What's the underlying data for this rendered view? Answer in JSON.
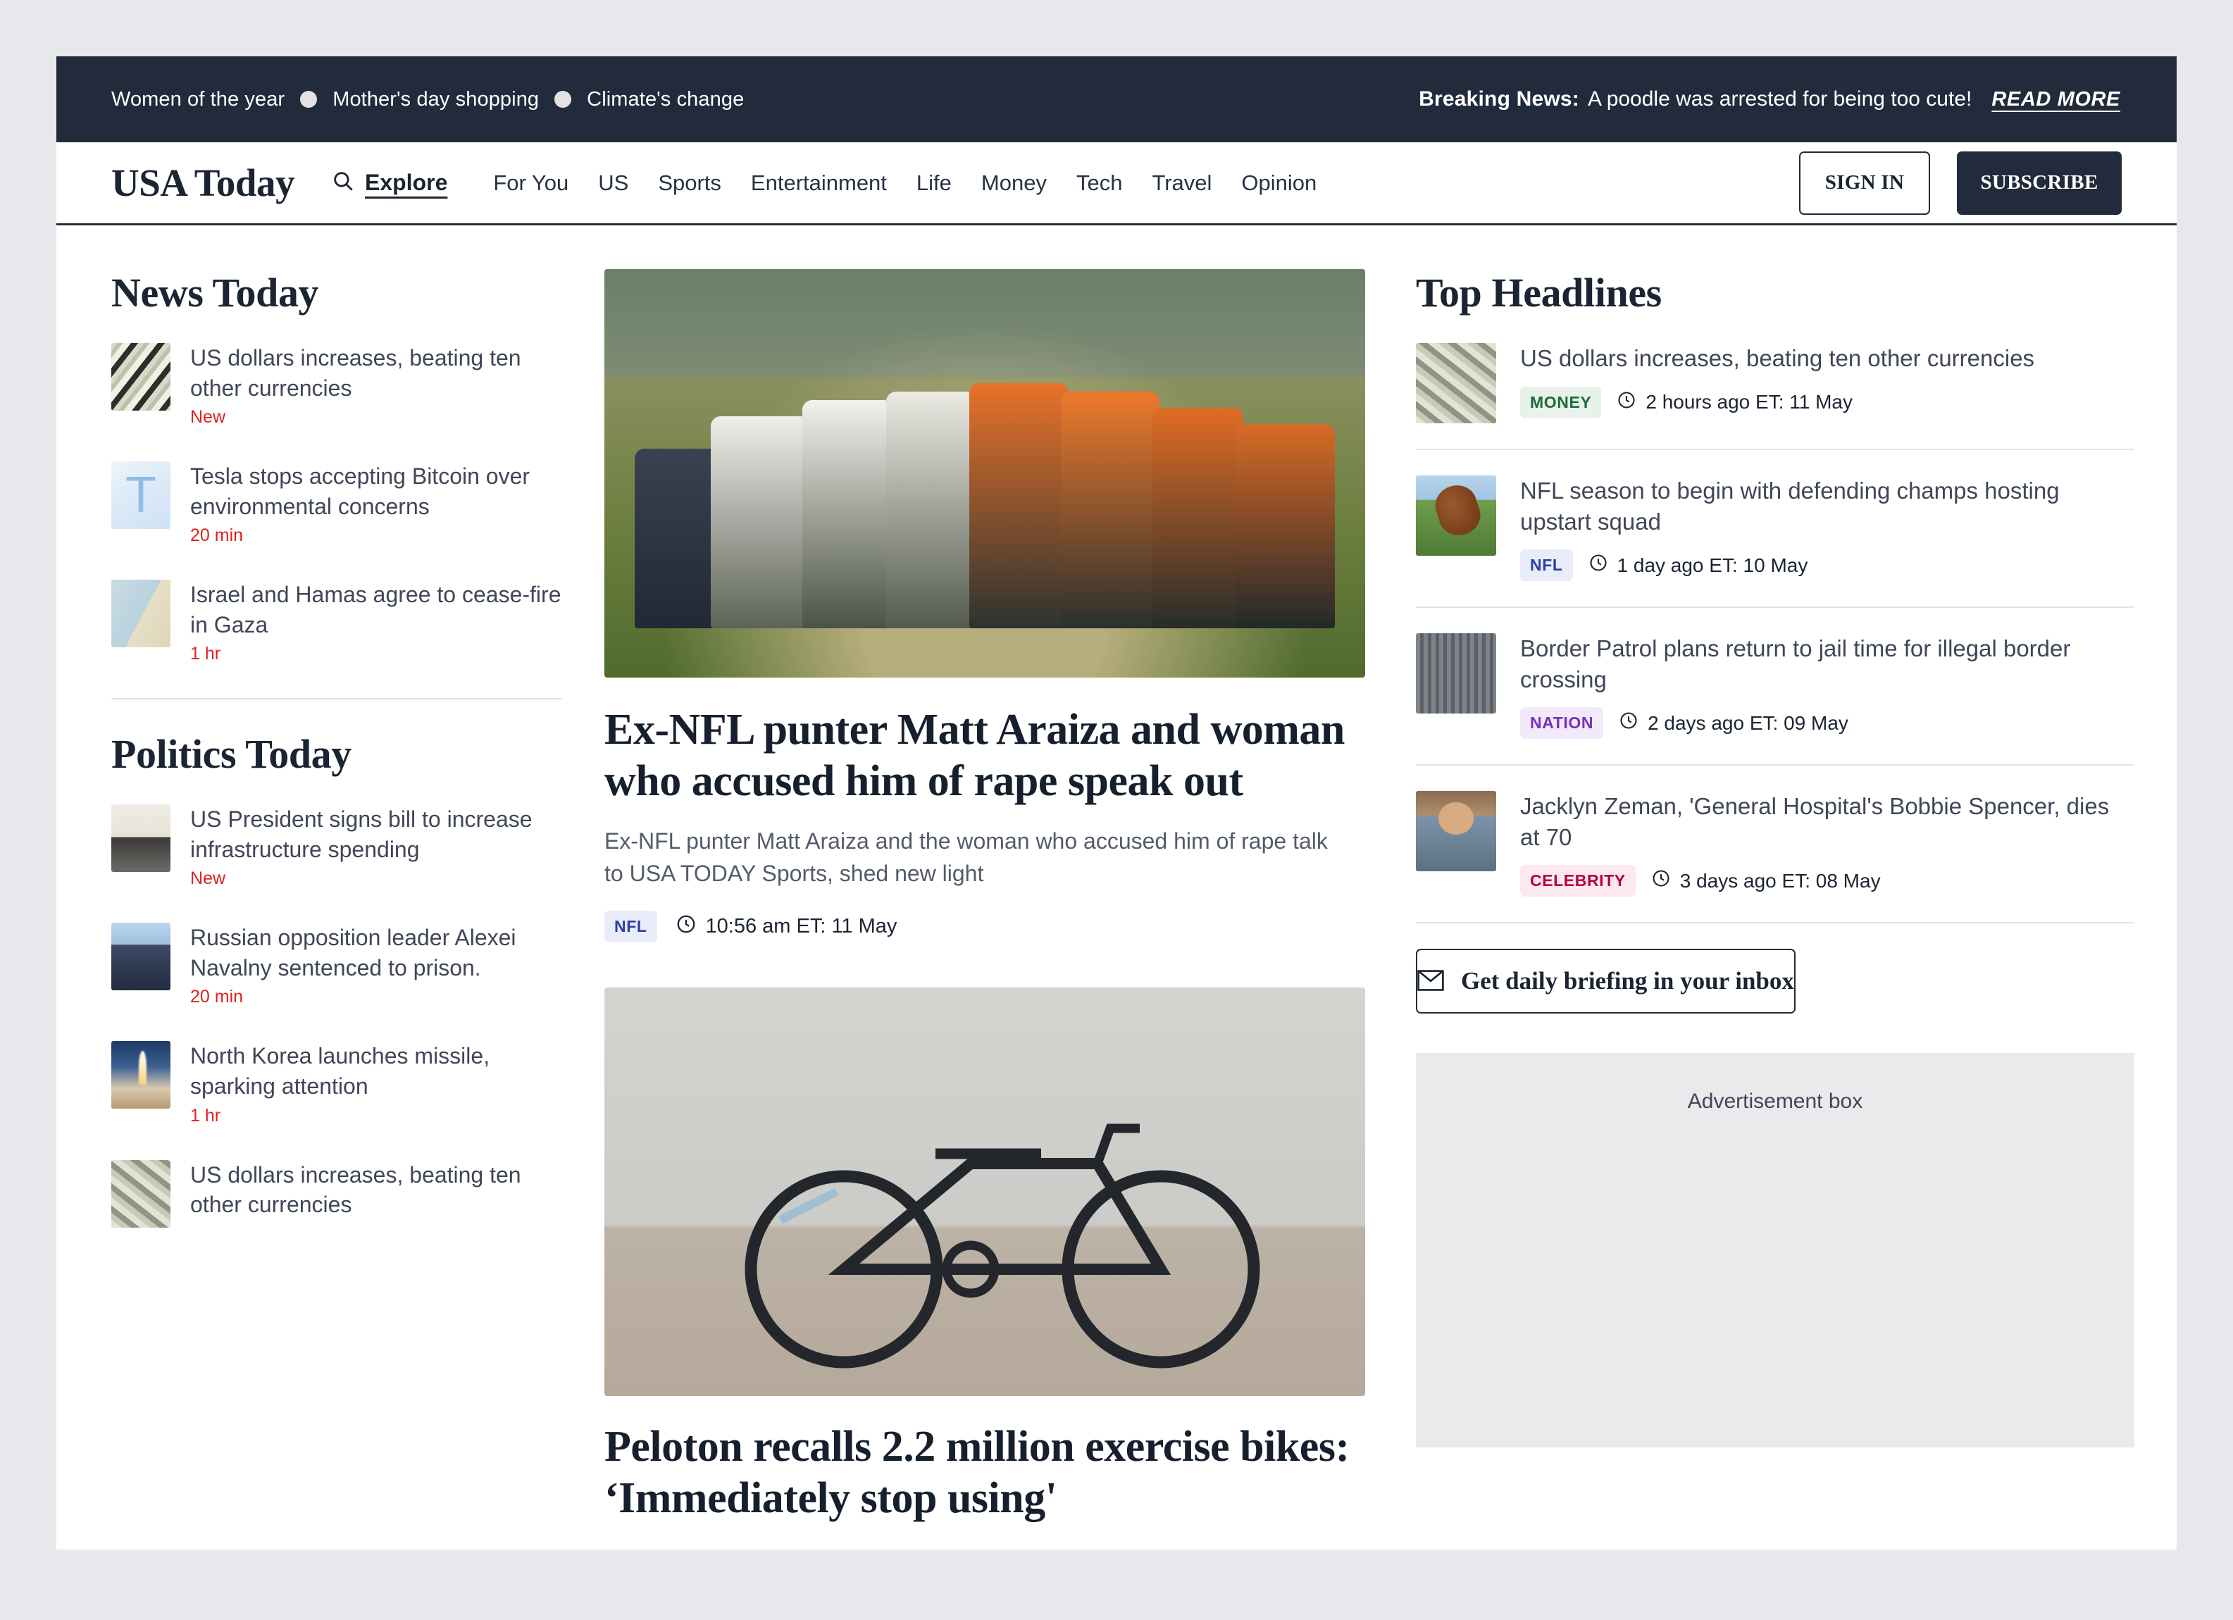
{
  "topbar": {
    "trending": [
      "Women of the year",
      "Mother's day shopping",
      "Climate's change"
    ],
    "breaking_label": "Breaking News:",
    "breaking_text": "A poodle was arrested for being too cute!",
    "read_more": "READ MORE"
  },
  "nav": {
    "logo": "USA Today",
    "explore": "Explore",
    "links": [
      "For You",
      "US",
      "Sports",
      "Entertainment",
      "Life",
      "Money",
      "Tech",
      "Travel",
      "Opinion"
    ],
    "sign_in": "SIGN IN",
    "subscribe": "SUBSCRIBE"
  },
  "news_today": {
    "title": "News Today",
    "items": [
      {
        "headline": "US dollars increases, beating ten other currencies",
        "time": "New",
        "image": "img-money"
      },
      {
        "headline": "Tesla stops accepting Bitcoin over environmental concerns",
        "time": "20 min",
        "image": "img-tesla"
      },
      {
        "headline": "Israel and Hamas agree to cease-fire in Gaza",
        "time": "1 hr",
        "image": "img-gaza"
      }
    ]
  },
  "politics_today": {
    "title": "Politics Today",
    "items": [
      {
        "headline": "US President signs bill to increase infrastructure spending",
        "time": "New",
        "image": "img-news"
      },
      {
        "headline": "Russian opposition leader Alexei Navalny sentenced to prison.",
        "time": "20 min",
        "image": "img-protest"
      },
      {
        "headline": "North Korea launches missile, sparking attention",
        "time": "1 hr",
        "image": "img-rocket"
      },
      {
        "headline": "US dollars increases, beating ten other currencies",
        "time": "",
        "image": "img-money2"
      }
    ]
  },
  "main": {
    "stories": [
      {
        "image": "rugby-scrum-photo",
        "title": "Ex-NFL punter Matt Araiza and woman who accused him of rape speak out",
        "dek": "Ex-NFL punter Matt Araiza and the woman who accused him of rape talk to USA TODAY Sports, shed new light",
        "tag": "NFL",
        "tag_style": "tag-nfl",
        "time": "10:56 am ET: 11 May"
      },
      {
        "image": "black-bicycle-photo",
        "title": "Peloton recalls 2.2 million exercise bikes: ‘Immediately stop using'",
        "dek": "",
        "tag": "",
        "tag_style": "",
        "time": ""
      }
    ]
  },
  "top_headlines": {
    "title": "Top Headlines",
    "items": [
      {
        "headline": "US dollars increases, beating ten other currencies",
        "tag": "MONEY",
        "tag_style": "tag-money",
        "time": "2 hours ago ET: 11 May",
        "image": "img-money2"
      },
      {
        "headline": "NFL season to begin with defending champs hosting upstart squad",
        "tag": "NFL",
        "tag_style": "tag-nfl",
        "time": "1 day ago ET: 10 May",
        "image": "img-football"
      },
      {
        "headline": "Border Patrol plans return to jail time for illegal border crossing",
        "tag": "NATION",
        "tag_style": "tag-nation",
        "time": "2 days ago ET: 09 May",
        "image": "img-jail"
      },
      {
        "headline": "Jacklyn Zeman, 'General Hospital's Bobbie Spencer, dies at 70",
        "tag": "CELEBRITY",
        "tag_style": "tag-celebrity",
        "time": "3 days ago ET: 08 May",
        "image": "img-person"
      }
    ],
    "briefing_button": "Get daily briefing in your inbox",
    "ad_label": "Advertisement box"
  },
  "colors": {
    "dark": "#212b3b",
    "accent_red": "#e02020",
    "page_bg": "#e6e8ec",
    "ad_bg": "#eaeaec"
  }
}
